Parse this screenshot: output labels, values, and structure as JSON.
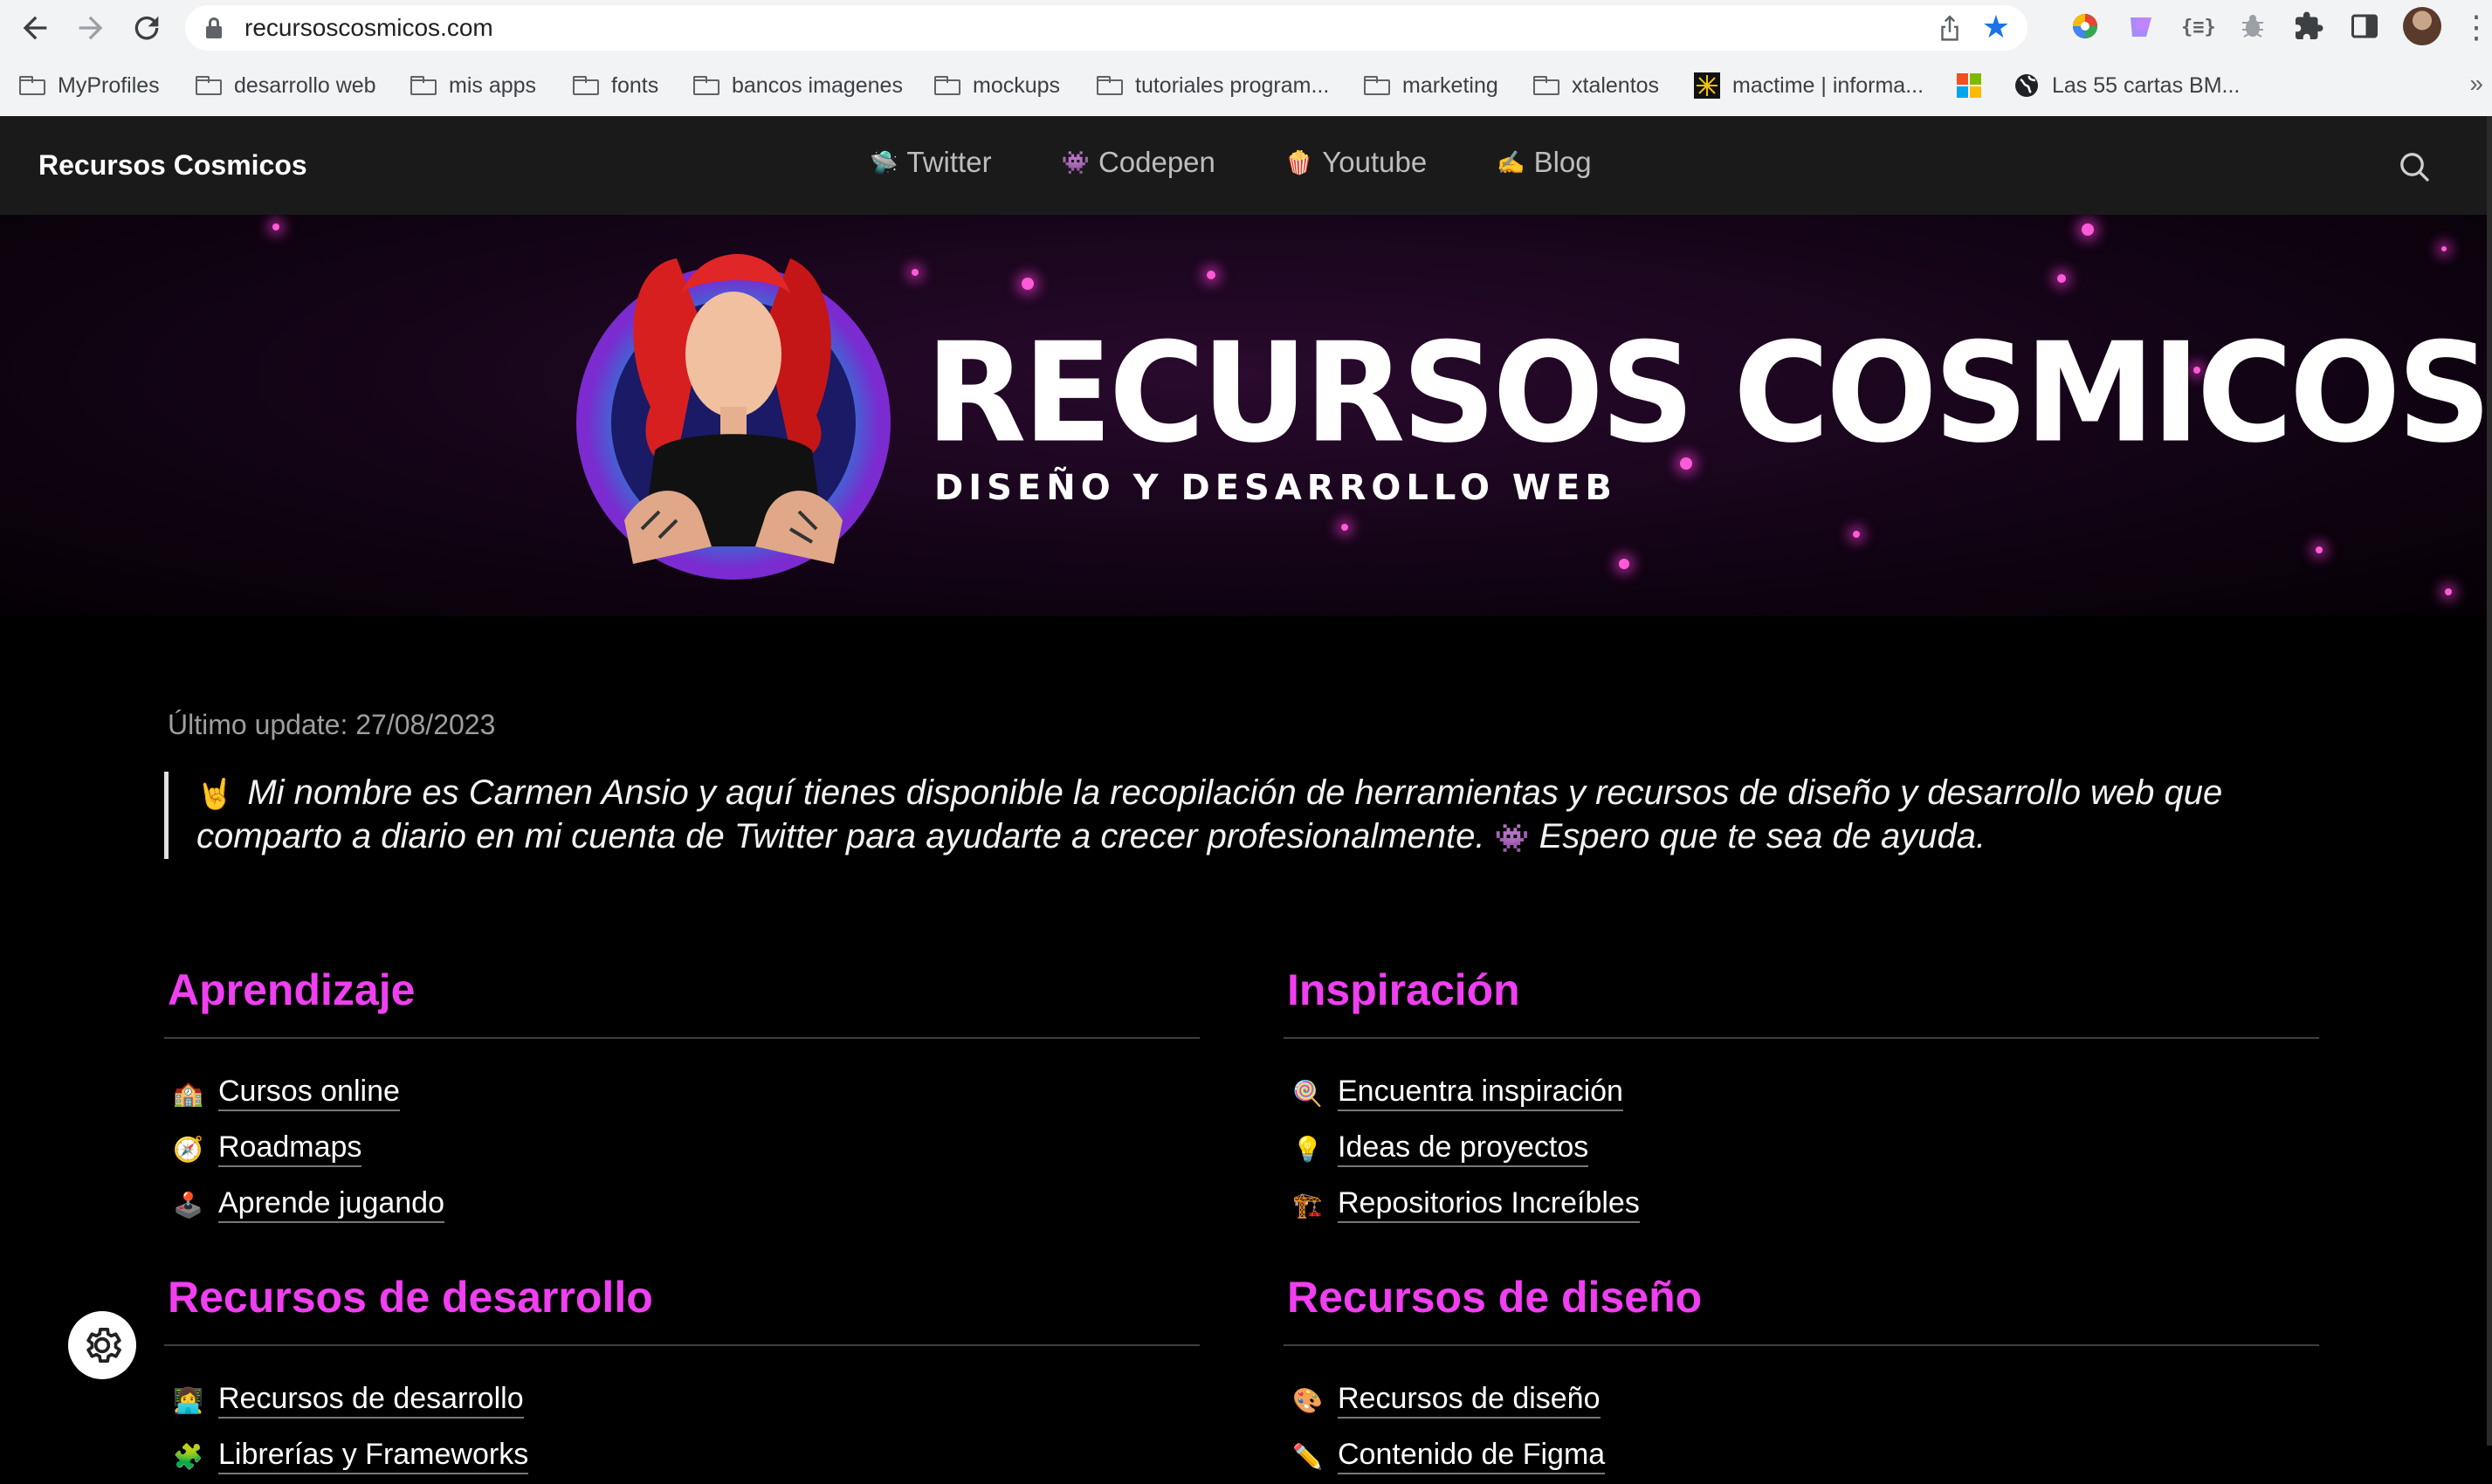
{
  "browser": {
    "url": "recursoscosmicos.com",
    "bookmarks": [
      {
        "label": "MyProfiles",
        "icon": "folder-icon"
      },
      {
        "label": "desarrollo web",
        "icon": "folder-icon"
      },
      {
        "label": "mis apps",
        "icon": "folder-icon"
      },
      {
        "label": "fonts",
        "icon": "folder-icon"
      },
      {
        "label": "bancos imagenes",
        "icon": "folder-icon"
      },
      {
        "label": "mockups",
        "icon": "folder-icon"
      },
      {
        "label": "tutoriales program...",
        "icon": "folder-icon"
      },
      {
        "label": "marketing",
        "icon": "folder-icon"
      },
      {
        "label": "xtalentos",
        "icon": "folder-icon"
      },
      {
        "label": "mactime | informa...",
        "icon": "mactime-favicon"
      },
      {
        "label": "",
        "icon": "microsoft-favicon"
      },
      {
        "label": "Las 55 cartas BM...",
        "icon": "globe-favicon"
      }
    ],
    "more_bookmarks": "»"
  },
  "site": {
    "brand": "Recursos Cosmicos",
    "nav": [
      {
        "emoji": "🛸",
        "label": "Twitter"
      },
      {
        "emoji": "👾",
        "label": "Codepen"
      },
      {
        "emoji": "🍿",
        "label": "Youtube"
      },
      {
        "emoji": "✍️",
        "label": "Blog"
      }
    ],
    "banner": {
      "title": "RECURSOS COSMICOS",
      "subtitle": "DISEÑO Y DESARROLLO WEB"
    },
    "updated": "Último update: 27/08/2023",
    "intro": {
      "lead_emoji": "🤘",
      "text_1": "Mi nombre es Carmen Ansio y aquí tienes disponible la recopilación de herramientas y recursos de diseño y desarrollo web que comparto a diario en mi cuenta de Twitter para ayudarte a crecer profesionalmente.",
      "mid_emoji": "👾",
      "text_2": "Espero que te sea de ayuda."
    },
    "sections": [
      {
        "title": "Aprendizaje",
        "items": [
          {
            "emoji": "🏫",
            "label": "Cursos online"
          },
          {
            "emoji": "🧭",
            "label": "Roadmaps"
          },
          {
            "emoji": "🕹️",
            "label": "Aprende jugando"
          }
        ]
      },
      {
        "title": "Inspiración",
        "items": [
          {
            "emoji": "🍭",
            "label": "Encuentra inspiración"
          },
          {
            "emoji": "💡",
            "label": "Ideas de proyectos"
          },
          {
            "emoji": "🏗️",
            "label": "Repositorios Increíbles"
          }
        ]
      },
      {
        "title": "Recursos de desarrollo",
        "items": [
          {
            "emoji": "👩‍💻",
            "label": "Recursos de desarrollo"
          },
          {
            "emoji": "🧩",
            "label": "Librerías y Frameworks"
          }
        ]
      },
      {
        "title": "Recursos de diseño",
        "items": [
          {
            "emoji": "🎨",
            "label": "Recursos de diseño"
          },
          {
            "emoji": "✏️",
            "label": "Contenido de Figma"
          }
        ]
      }
    ]
  },
  "colors": {
    "accent": "#ef3ff0",
    "background": "#000000",
    "header": "#1a1a1a",
    "bookmark_star": "#1a73e8"
  }
}
